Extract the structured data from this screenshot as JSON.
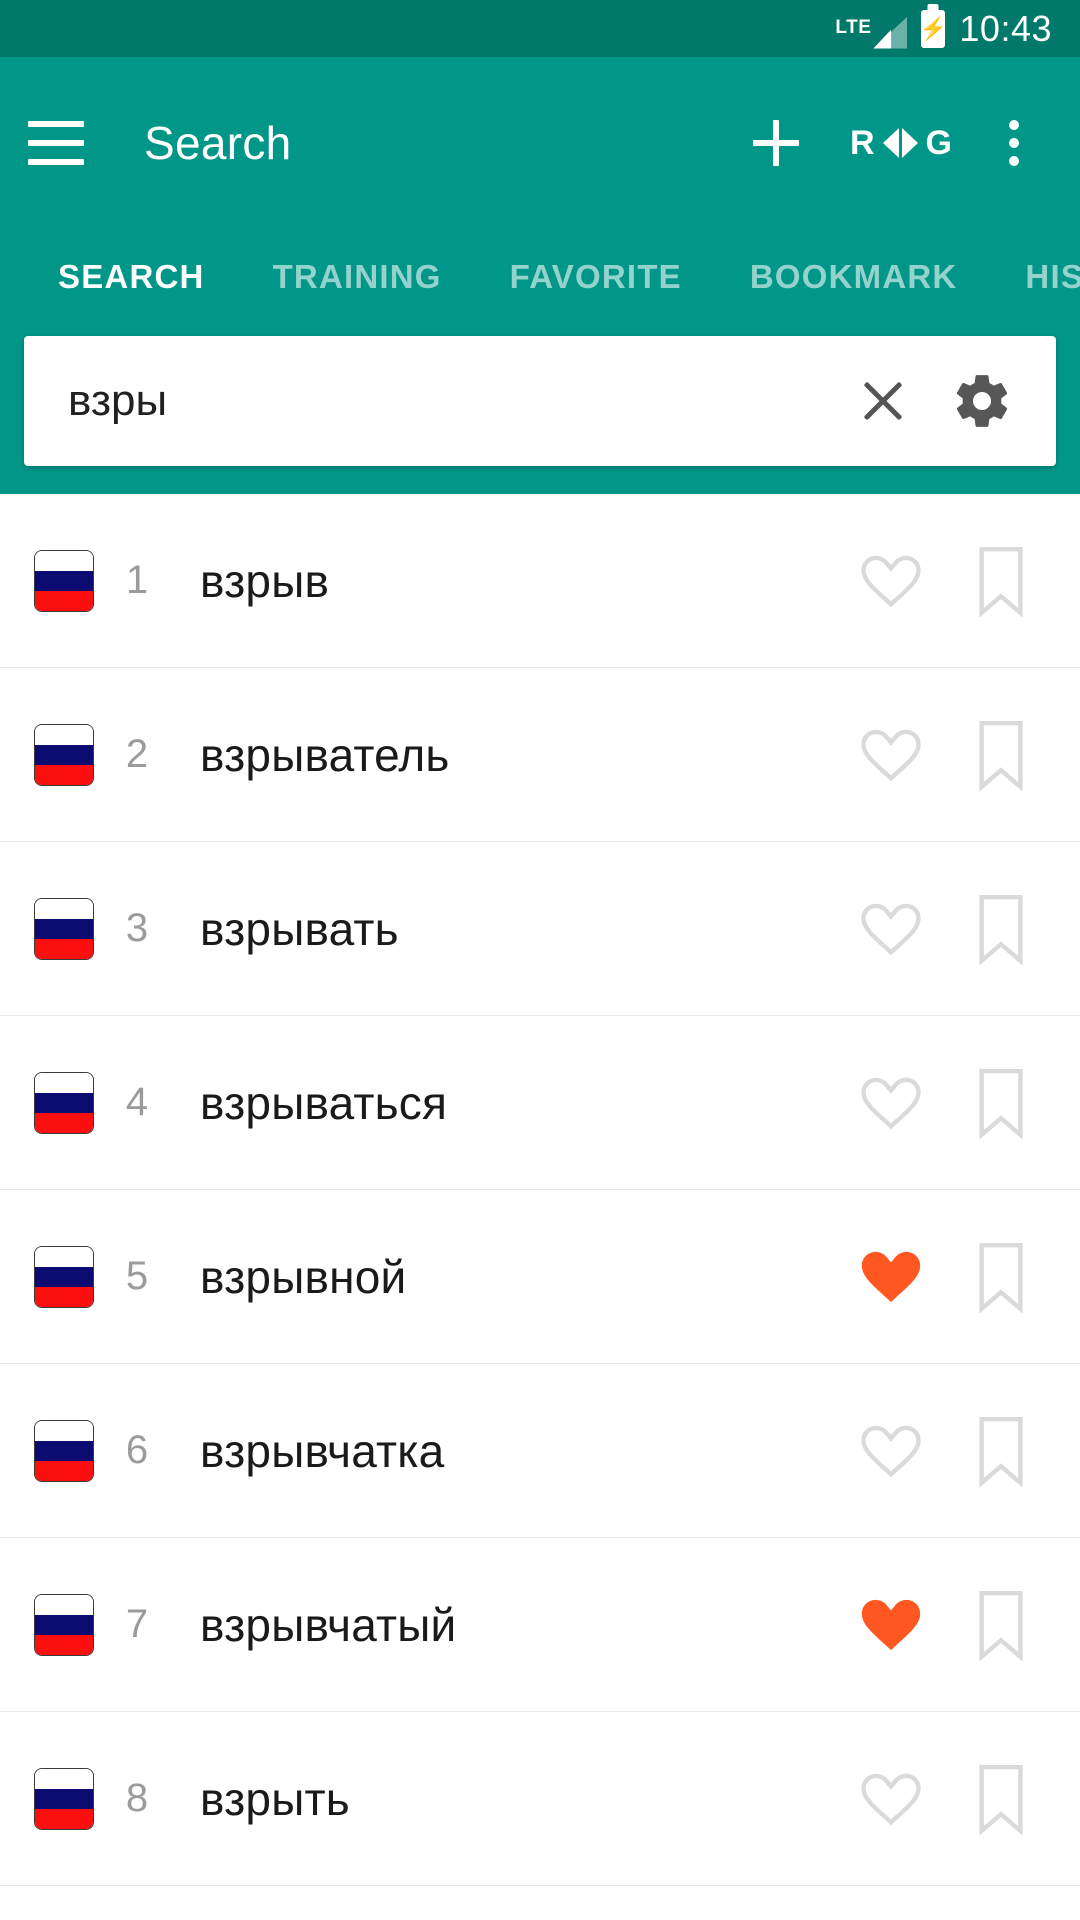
{
  "status_bar": {
    "network_label": "LTE",
    "signal_icon": "signal-bars-icon",
    "battery_icon": "battery-charging-icon",
    "time": "10:43"
  },
  "appbar": {
    "menu_icon": "hamburger-menu-icon",
    "title": "Search",
    "add_icon": "plus-icon",
    "lang_from": "R",
    "lang_swap_icon": "swap-arrows-icon",
    "lang_to": "G",
    "overflow_icon": "overflow-menu-icon"
  },
  "tabs": [
    {
      "label": "SEARCH",
      "active": true
    },
    {
      "label": "TRAINING",
      "active": false
    },
    {
      "label": "FAVORITE",
      "active": false
    },
    {
      "label": "BOOKMARK",
      "active": false
    },
    {
      "label": "HISTORY",
      "active": false
    }
  ],
  "search": {
    "value": "взры",
    "placeholder": "",
    "clear_icon": "close-icon",
    "settings_icon": "gear-icon"
  },
  "results": [
    {
      "index": "1",
      "word": "взрыв",
      "flag": "russia-flag-icon",
      "favorite": false,
      "bookmarked": false
    },
    {
      "index": "2",
      "word": "взрыватель",
      "flag": "russia-flag-icon",
      "favorite": false,
      "bookmarked": false
    },
    {
      "index": "3",
      "word": "взрывать",
      "flag": "russia-flag-icon",
      "favorite": false,
      "bookmarked": false
    },
    {
      "index": "4",
      "word": "взрываться",
      "flag": "russia-flag-icon",
      "favorite": false,
      "bookmarked": false
    },
    {
      "index": "5",
      "word": "взрывной",
      "flag": "russia-flag-icon",
      "favorite": true,
      "bookmarked": false
    },
    {
      "index": "6",
      "word": "взрывчатка",
      "flag": "russia-flag-icon",
      "favorite": false,
      "bookmarked": false
    },
    {
      "index": "7",
      "word": "взрывчатый",
      "flag": "russia-flag-icon",
      "favorite": true,
      "bookmarked": false
    },
    {
      "index": "8",
      "word": "взрыть",
      "flag": "russia-flag-icon",
      "favorite": false,
      "bookmarked": false
    }
  ],
  "colors": {
    "status_bar": "#00796B",
    "app_bar": "#009688",
    "favorite_active": "#FF5722",
    "icon_outline": "#dadada",
    "index_text": "#9b9b9b"
  }
}
